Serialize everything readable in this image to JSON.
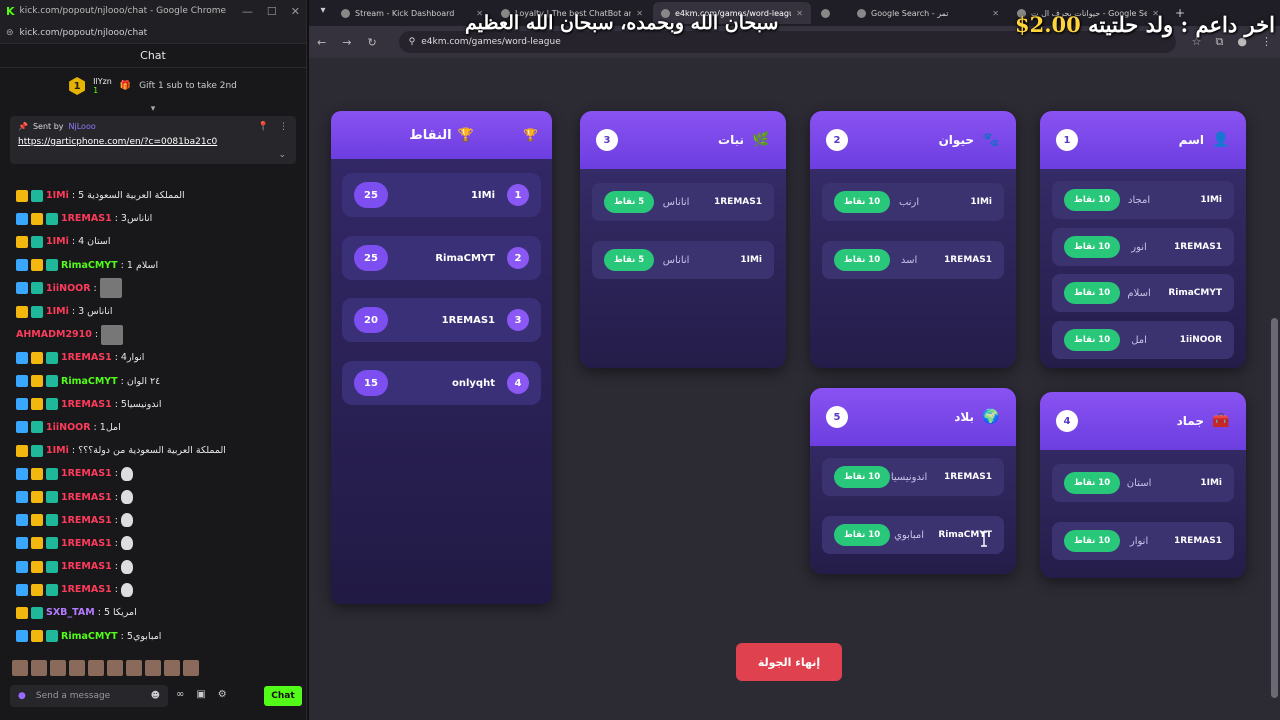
{
  "chat_window": {
    "title": "kick.com/popout/njlooo/chat - Google Chrome",
    "url": "kick.com/popout/njlooo/chat",
    "header": "Chat",
    "gift_rank": "1",
    "gift_user": "IlYzn",
    "gift_user_level": "1",
    "gift_text": "Gift 1 sub to take 2nd",
    "pinned_sent_by": "Sent by",
    "pinned_user": "NjLooo",
    "pinned_link": "https://garticphone.com/en/?c=0081ba21c0",
    "input_placeholder": "Send a message",
    "send_label": "Chat",
    "messages": [
      {
        "user": "1IMi",
        "color": "#ff3b5c",
        "text": ": المملكة العربية السعودية 5",
        "badges": [
          "crown",
          "og"
        ]
      },
      {
        "user": "1REMAS1",
        "color": "#ff3b5c",
        "text": ": اناناس3",
        "badges": [
          "sub",
          "crown",
          "og"
        ]
      },
      {
        "user": "1IMi",
        "color": "#ff3b5c",
        "text": ": استان 4",
        "badges": [
          "crown",
          "og"
        ]
      },
      {
        "user": "RimaCMYT",
        "color": "#53fc18",
        "text": ": اسلام 1",
        "badges": [
          "sub",
          "crown",
          "og"
        ]
      },
      {
        "user": "1iiNOOR",
        "color": "#ff3b5c",
        "text": ":",
        "badges": [
          "sub",
          "og"
        ],
        "img": true
      },
      {
        "user": "1IMi",
        "color": "#ff3b5c",
        "text": ": اناناس 3",
        "badges": [
          "crown",
          "og"
        ]
      },
      {
        "user": "AHMADM2910",
        "color": "#ff3b5c",
        "text": ":",
        "badges": [],
        "img": true
      },
      {
        "user": "1REMAS1",
        "color": "#ff3b5c",
        "text": ": انوار4",
        "badges": [
          "sub",
          "crown",
          "og"
        ]
      },
      {
        "user": "RimaCMYT",
        "color": "#53fc18",
        "text": ": ٢٤ الوان",
        "badges": [
          "sub",
          "crown",
          "og"
        ]
      },
      {
        "user": "1REMAS1",
        "color": "#ff3b5c",
        "text": ": اندونيسيا5",
        "badges": [
          "sub",
          "crown",
          "og"
        ]
      },
      {
        "user": "1iiNOOR",
        "color": "#ff3b5c",
        "text": ": امل1",
        "badges": [
          "sub",
          "og"
        ]
      },
      {
        "user": "1IMi",
        "color": "#ff3b5c",
        "text": ": المملكة العربية السعودية من دولة؟؟؟",
        "badges": [
          "crown",
          "og"
        ]
      },
      {
        "user": "1REMAS1",
        "color": "#ff3b5c",
        "text": ":",
        "badges": [
          "sub",
          "crown",
          "og"
        ],
        "emote": true
      },
      {
        "user": "1REMAS1",
        "color": "#ff3b5c",
        "text": ":",
        "badges": [
          "sub",
          "crown",
          "og"
        ],
        "emote": true
      },
      {
        "user": "1REMAS1",
        "color": "#ff3b5c",
        "text": ":",
        "badges": [
          "sub",
          "crown",
          "og"
        ],
        "emote": true
      },
      {
        "user": "1REMAS1",
        "color": "#ff3b5c",
        "text": ":",
        "badges": [
          "sub",
          "crown",
          "og"
        ],
        "emote": true
      },
      {
        "user": "1REMAS1",
        "color": "#ff3b5c",
        "text": ":",
        "badges": [
          "sub",
          "crown",
          "og"
        ],
        "emote": true
      },
      {
        "user": "1REMAS1",
        "color": "#ff3b5c",
        "text": ":",
        "badges": [
          "sub",
          "crown",
          "og"
        ],
        "emote": true
      },
      {
        "user": "SXB_TAM",
        "color": "#b57bff",
        "text": ": امريكا 5",
        "badges": [
          "crown",
          "og"
        ]
      },
      {
        "user": "RimaCMYT",
        "color": "#53fc18",
        "text": ": امبابوي5",
        "badges": [
          "sub",
          "crown",
          "og"
        ]
      }
    ]
  },
  "browser": {
    "tabs": [
      {
        "label": "Stream - Kick Dashboard",
        "active": false
      },
      {
        "label": "Loyalty | The best ChatBot and",
        "active": false
      },
      {
        "label": "e4km.com/games/word-league",
        "active": true
      },
      {
        "label": "",
        "active": false
      },
      {
        "label": "Google Search - تمر",
        "active": false
      },
      {
        "label": "حيوانات بحرف ال ت - Google Search",
        "active": false
      }
    ],
    "url": "e4km.com/games/word-league"
  },
  "overlay": {
    "dhikr": "سبحان الله وبحمده، سبحان الله العظيم",
    "donation_prefix": "ولد حلتيته",
    "donation_label": "اخر داعم :",
    "donation_amount": "$2.00"
  },
  "game": {
    "scoreboard": {
      "title": "النقاط",
      "rows": [
        {
          "rank": "1",
          "name": "1IMi",
          "score": "25"
        },
        {
          "rank": "2",
          "name": "RimaCMYT",
          "score": "25"
        },
        {
          "rank": "3",
          "name": "1REMAS1",
          "score": "20"
        },
        {
          "rank": "4",
          "name": "onlyqht",
          "score": "15"
        }
      ]
    },
    "categories": [
      {
        "num": "1",
        "title": "اسم",
        "answers": [
          {
            "user": "1IMi",
            "word": "امجاد",
            "points": "10 نقاط"
          },
          {
            "user": "1REMAS1",
            "word": "انور",
            "points": "10 نقاط"
          },
          {
            "user": "RimaCMYT",
            "word": "اسلام",
            "points": "10 نقاط"
          },
          {
            "user": "1iiNOOR",
            "word": "امل",
            "points": "10 نقاط"
          }
        ]
      },
      {
        "num": "2",
        "title": "حيوان",
        "answers": [
          {
            "user": "1IMi",
            "word": "ارنب",
            "points": "10 نقاط"
          },
          {
            "user": "1REMAS1",
            "word": "اسد",
            "points": "10 نقاط"
          }
        ]
      },
      {
        "num": "3",
        "title": "نبات",
        "answers": [
          {
            "user": "1REMAS1",
            "word": "اناناس",
            "points": "5 نقاط"
          },
          {
            "user": "1IMi",
            "word": "اناناس",
            "points": "5 نقاط"
          }
        ]
      },
      {
        "num": "4",
        "title": "جماد",
        "answers": [
          {
            "user": "1IMi",
            "word": "استان",
            "points": "10 نقاط"
          },
          {
            "user": "1REMAS1",
            "word": "انوار",
            "points": "10 نقاط"
          }
        ]
      },
      {
        "num": "5",
        "title": "بلاد",
        "answers": [
          {
            "user": "1REMAS1",
            "word": "اندونيسيا",
            "points": "10 نقاط"
          },
          {
            "user": "RimaCMYT",
            "word": "امبابوي",
            "points": "10 نقاط"
          }
        ]
      }
    ],
    "end_round_label": "إنهاء الجولة"
  },
  "colors": {
    "accent": "#8a52f2",
    "points_green": "#29c77a",
    "end_red": "#e0414f",
    "kick_green": "#53fc18"
  }
}
